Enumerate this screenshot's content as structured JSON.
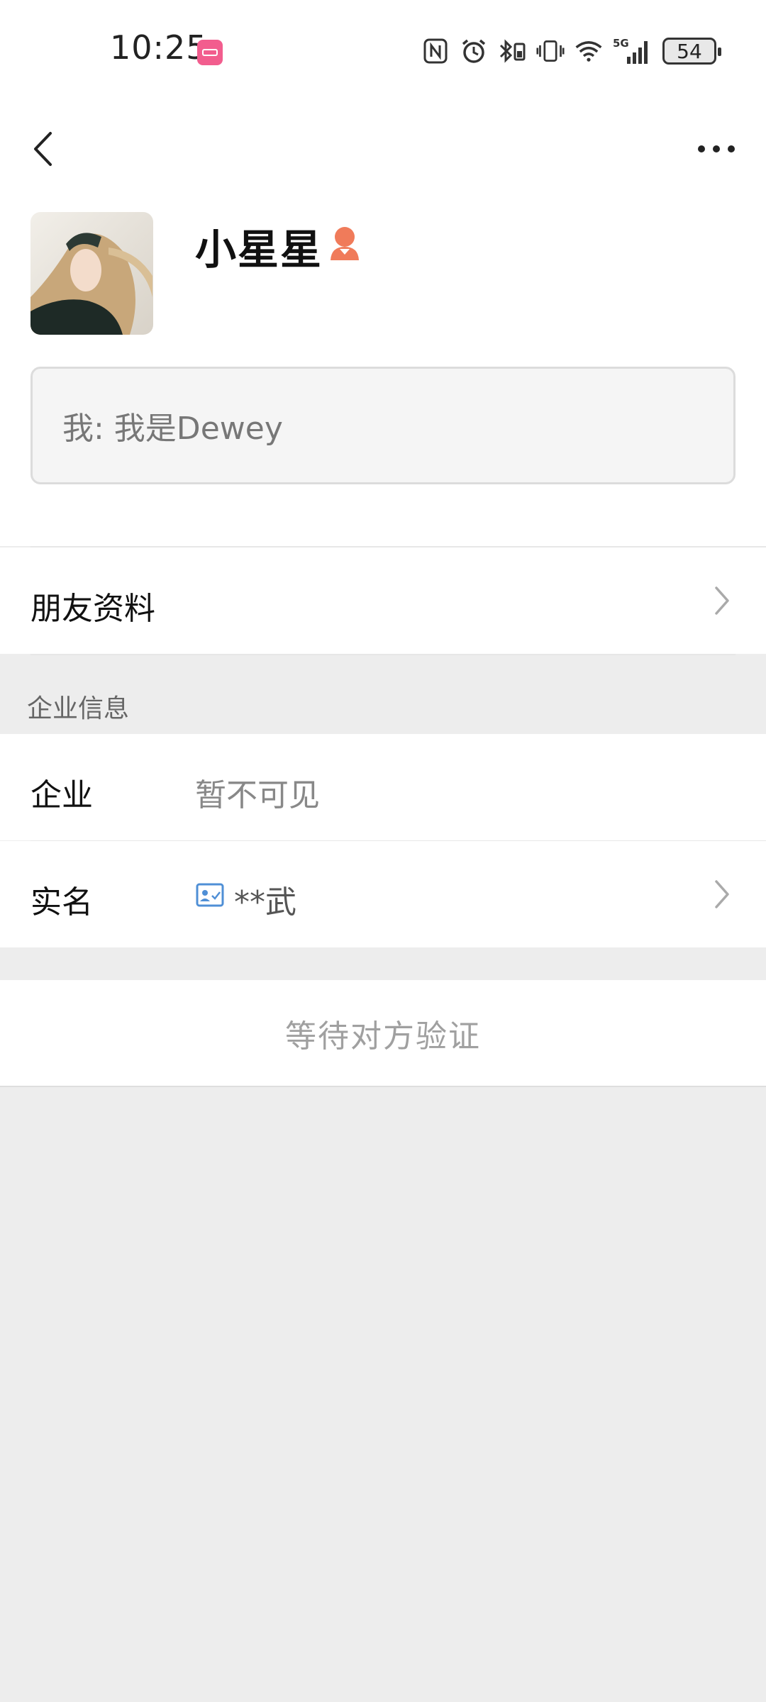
{
  "status_bar": {
    "time": "10:25",
    "battery": "54",
    "network": "5G",
    "icons": [
      "nfc-icon",
      "alarm-icon",
      "bluetooth-icon",
      "vibrate-icon",
      "wifi-icon",
      "signal-icon",
      "battery-icon"
    ]
  },
  "header": {
    "back_icon": "chevron-left-icon",
    "more_icon": "more-horizontal-icon"
  },
  "profile": {
    "nickname": "小星星",
    "gender_icon": "female-icon",
    "gender_color": "#f07b5a",
    "note": "我: 我是Dewey"
  },
  "friend_info": {
    "label": "朋友资料"
  },
  "enterprise": {
    "section_title": "企业信息",
    "company_label": "企业",
    "company_value": "暂不可见",
    "realname_label": "实名",
    "realname_value": "**武",
    "realname_icon": "id-card-icon",
    "realname_icon_color": "#4f8fd6"
  },
  "action": {
    "verify_label": "等待对方验证"
  }
}
